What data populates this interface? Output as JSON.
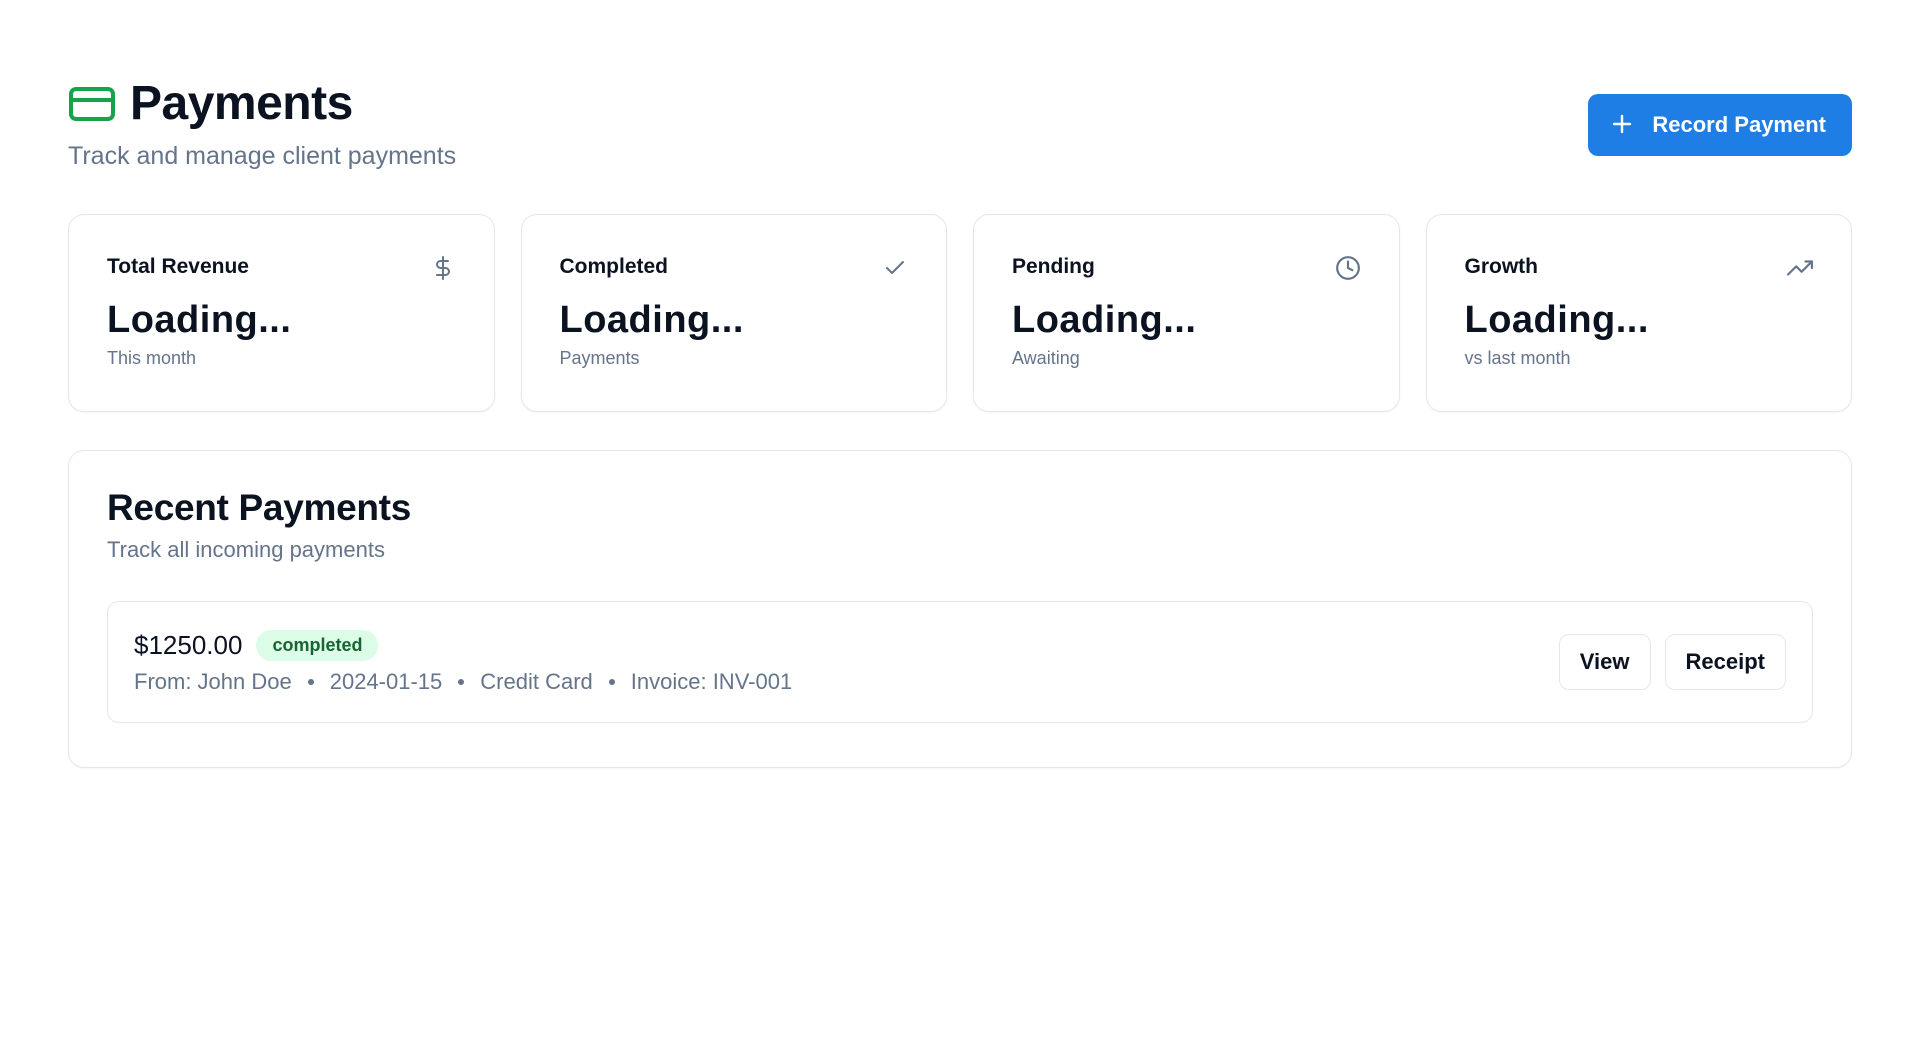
{
  "header": {
    "title": "Payments",
    "subtitle": "Track and manage client payments",
    "icon": "credit-card-icon",
    "accent_color": "#16a34a",
    "record_button_label": "Record Payment"
  },
  "stats": [
    {
      "label": "Total Revenue",
      "value": "Loading...",
      "sub": "This month",
      "icon": "dollar-icon"
    },
    {
      "label": "Completed",
      "value": "Loading...",
      "sub": "Payments",
      "icon": "check-icon"
    },
    {
      "label": "Pending",
      "value": "Loading...",
      "sub": "Awaiting",
      "icon": "clock-icon"
    },
    {
      "label": "Growth",
      "value": "Loading...",
      "sub": "vs last month",
      "icon": "trending-up-icon"
    }
  ],
  "recent": {
    "title": "Recent Payments",
    "subtitle": "Track all incoming payments",
    "payments": [
      {
        "amount": "$1250.00",
        "status": "completed",
        "from": "From: John Doe",
        "date": "2024-01-15",
        "method": "Credit Card",
        "invoice": "Invoice: INV-001",
        "view_label": "View",
        "receipt_label": "Receipt"
      }
    ]
  },
  "colors": {
    "primary": "#1e7ee6",
    "badge_bg": "#dcfce7",
    "badge_text": "#166534",
    "muted": "#64748b"
  }
}
